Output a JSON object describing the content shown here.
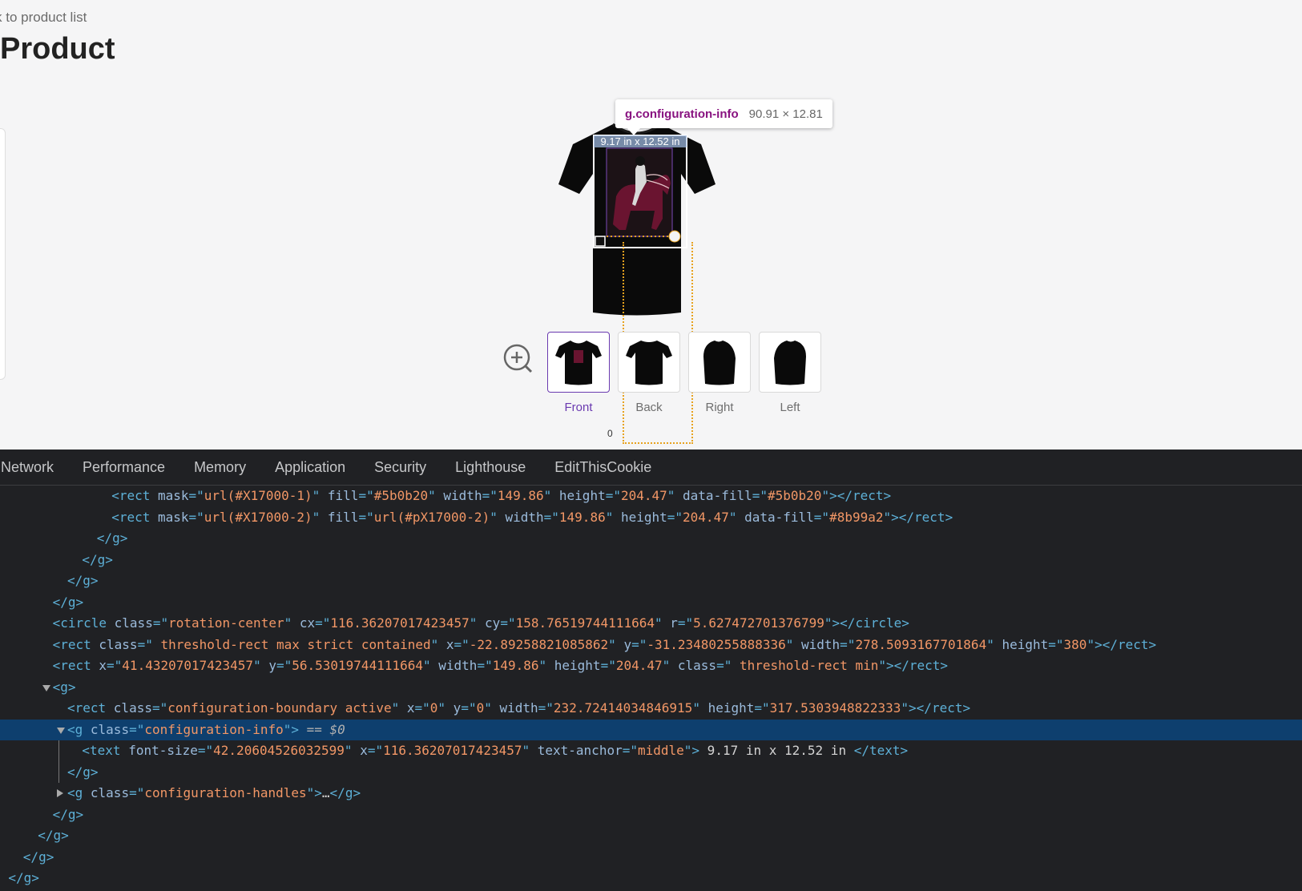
{
  "page": {
    "back_link": "k to product list",
    "title": "Product"
  },
  "inspector_tooltip": {
    "selector": "g.configuration-info",
    "dimensions": "90.91 × 12.81"
  },
  "canvas": {
    "size_label": "9.17 in x 12.52 in",
    "ruler_zero": "0"
  },
  "views": [
    {
      "label": "Front",
      "selected": true
    },
    {
      "label": "Back",
      "selected": false
    },
    {
      "label": "Right",
      "selected": false
    },
    {
      "label": "Left",
      "selected": false
    }
  ],
  "devtools": {
    "tabs": [
      "Network",
      "Performance",
      "Memory",
      "Application",
      "Security",
      "Lighthouse",
      "EditThisCookie"
    ],
    "selected_suffix": " == $0",
    "lines": [
      {
        "indent": 8,
        "parts": [
          [
            "tag",
            "<rect "
          ],
          [
            "at",
            "mask"
          ],
          [
            "tag",
            "=\""
          ],
          [
            "av",
            "url(#X17000-1)"
          ],
          [
            "tag",
            "\" "
          ],
          [
            "at",
            "fill"
          ],
          [
            "tag",
            "=\""
          ],
          [
            "av",
            "#5b0b20"
          ],
          [
            "tag",
            "\" "
          ],
          [
            "at",
            "width"
          ],
          [
            "tag",
            "=\""
          ],
          [
            "av",
            "149.86"
          ],
          [
            "tag",
            "\" "
          ],
          [
            "at",
            "height"
          ],
          [
            "tag",
            "=\""
          ],
          [
            "av",
            "204.47"
          ],
          [
            "tag",
            "\" "
          ],
          [
            "at",
            "data-fill"
          ],
          [
            "tag",
            "=\""
          ],
          [
            "av",
            "#5b0b20"
          ],
          [
            "tag",
            "\"></rect>"
          ]
        ]
      },
      {
        "indent": 8,
        "parts": [
          [
            "tag",
            "<rect "
          ],
          [
            "at",
            "mask"
          ],
          [
            "tag",
            "=\""
          ],
          [
            "av",
            "url(#X17000-2)"
          ],
          [
            "tag",
            "\" "
          ],
          [
            "at",
            "fill"
          ],
          [
            "tag",
            "=\""
          ],
          [
            "av",
            "url(#pX17000-2)"
          ],
          [
            "tag",
            "\" "
          ],
          [
            "at",
            "width"
          ],
          [
            "tag",
            "=\""
          ],
          [
            "av",
            "149.86"
          ],
          [
            "tag",
            "\" "
          ],
          [
            "at",
            "height"
          ],
          [
            "tag",
            "=\""
          ],
          [
            "av",
            "204.47"
          ],
          [
            "tag",
            "\" "
          ],
          [
            "at",
            "data-fill"
          ],
          [
            "tag",
            "=\""
          ],
          [
            "av",
            "#8b99a2"
          ],
          [
            "tag",
            "\"></rect>"
          ]
        ]
      },
      {
        "indent": 7,
        "parts": [
          [
            "tag",
            "</g>"
          ]
        ]
      },
      {
        "indent": 6,
        "parts": [
          [
            "tag",
            "</g>"
          ]
        ]
      },
      {
        "indent": 5,
        "parts": [
          [
            "tag",
            "</g>"
          ]
        ]
      },
      {
        "indent": 4,
        "parts": [
          [
            "tag",
            "</g>"
          ]
        ]
      },
      {
        "indent": 4,
        "parts": [
          [
            "tag",
            "<circle "
          ],
          [
            "at",
            "class"
          ],
          [
            "tag",
            "=\""
          ],
          [
            "av",
            "rotation-center"
          ],
          [
            "tag",
            "\" "
          ],
          [
            "at",
            "cx"
          ],
          [
            "tag",
            "=\""
          ],
          [
            "av",
            "116.36207017423457"
          ],
          [
            "tag",
            "\" "
          ],
          [
            "at",
            "cy"
          ],
          [
            "tag",
            "=\""
          ],
          [
            "av",
            "158.76519744111664"
          ],
          [
            "tag",
            "\" "
          ],
          [
            "at",
            "r"
          ],
          [
            "tag",
            "=\""
          ],
          [
            "av",
            "5.627472701376799"
          ],
          [
            "tag",
            "\"></circle>"
          ]
        ]
      },
      {
        "indent": 4,
        "parts": [
          [
            "tag",
            "<rect "
          ],
          [
            "at",
            "class"
          ],
          [
            "tag",
            "=\""
          ],
          [
            "av",
            " threshold-rect max strict contained"
          ],
          [
            "tag",
            "\" "
          ],
          [
            "at",
            "x"
          ],
          [
            "tag",
            "=\""
          ],
          [
            "av",
            "-22.89258821085862"
          ],
          [
            "tag",
            "\" "
          ],
          [
            "at",
            "y"
          ],
          [
            "tag",
            "=\""
          ],
          [
            "av",
            "-31.23480255888336"
          ],
          [
            "tag",
            "\" "
          ],
          [
            "at",
            "width"
          ],
          [
            "tag",
            "=\""
          ],
          [
            "av",
            "278.5093167701864"
          ],
          [
            "tag",
            "\" "
          ],
          [
            "at",
            "height"
          ],
          [
            "tag",
            "=\""
          ],
          [
            "av",
            "380"
          ],
          [
            "tag",
            "\"></rect>"
          ]
        ]
      },
      {
        "indent": 4,
        "parts": [
          [
            "tag",
            "<rect "
          ],
          [
            "at",
            "x"
          ],
          [
            "tag",
            "=\""
          ],
          [
            "av",
            "41.43207017423457"
          ],
          [
            "tag",
            "\" "
          ],
          [
            "at",
            "y"
          ],
          [
            "tag",
            "=\""
          ],
          [
            "av",
            "56.53019744111664"
          ],
          [
            "tag",
            "\" "
          ],
          [
            "at",
            "width"
          ],
          [
            "tag",
            "=\""
          ],
          [
            "av",
            "149.86"
          ],
          [
            "tag",
            "\" "
          ],
          [
            "at",
            "height"
          ],
          [
            "tag",
            "=\""
          ],
          [
            "av",
            "204.47"
          ],
          [
            "tag",
            "\" "
          ],
          [
            "at",
            "class"
          ],
          [
            "tag",
            "=\""
          ],
          [
            "av",
            " threshold-rect min"
          ],
          [
            "tag",
            "\"></rect>"
          ]
        ]
      },
      {
        "indent": 4,
        "toggle": "down",
        "parts": [
          [
            "tag",
            "<g>"
          ]
        ]
      },
      {
        "indent": 5,
        "parts": [
          [
            "tag",
            "<rect "
          ],
          [
            "at",
            "class"
          ],
          [
            "tag",
            "=\""
          ],
          [
            "av",
            "configuration-boundary active"
          ],
          [
            "tag",
            "\" "
          ],
          [
            "at",
            "x"
          ],
          [
            "tag",
            "=\""
          ],
          [
            "av",
            "0"
          ],
          [
            "tag",
            "\" "
          ],
          [
            "at",
            "y"
          ],
          [
            "tag",
            "=\""
          ],
          [
            "av",
            "0"
          ],
          [
            "tag",
            "\" "
          ],
          [
            "at",
            "width"
          ],
          [
            "tag",
            "=\""
          ],
          [
            "av",
            "232.72414034846915"
          ],
          [
            "tag",
            "\" "
          ],
          [
            "at",
            "height"
          ],
          [
            "tag",
            "=\""
          ],
          [
            "av",
            "317.5303948822333"
          ],
          [
            "tag",
            "\"></rect>"
          ]
        ]
      },
      {
        "indent": 5,
        "toggle": "down",
        "selected": true,
        "parts": [
          [
            "tag",
            "<g "
          ],
          [
            "at",
            "class"
          ],
          [
            "tag",
            "=\""
          ],
          [
            "av",
            "configuration-info"
          ],
          [
            "tag",
            "\">"
          ]
        ]
      },
      {
        "indent": 6,
        "vbar": true,
        "parts": [
          [
            "tag",
            "<text "
          ],
          [
            "at",
            "font-size"
          ],
          [
            "tag",
            "=\""
          ],
          [
            "av",
            "42.20604526032599"
          ],
          [
            "tag",
            "\" "
          ],
          [
            "at",
            "x"
          ],
          [
            "tag",
            "=\""
          ],
          [
            "av",
            "116.36207017423457"
          ],
          [
            "tag",
            "\" "
          ],
          [
            "at",
            "text-anchor"
          ],
          [
            "tag",
            "=\""
          ],
          [
            "av",
            "middle"
          ],
          [
            "tag",
            "\">"
          ],
          [
            "tx",
            " 9.17 in x 12.52 in "
          ],
          [
            "tag",
            "</text>"
          ]
        ]
      },
      {
        "indent": 5,
        "vbar": true,
        "parts": [
          [
            "tag",
            "</g>"
          ]
        ]
      },
      {
        "indent": 5,
        "toggle": "right",
        "parts": [
          [
            "tag",
            "<g "
          ],
          [
            "at",
            "class"
          ],
          [
            "tag",
            "=\""
          ],
          [
            "av",
            "configuration-handles"
          ],
          [
            "tag",
            "\">"
          ],
          [
            "tx",
            "…"
          ],
          [
            "tag",
            "</g>"
          ]
        ]
      },
      {
        "indent": 4,
        "parts": [
          [
            "tag",
            "</g>"
          ]
        ]
      },
      {
        "indent": 3,
        "parts": [
          [
            "tag",
            "</g>"
          ]
        ]
      },
      {
        "indent": 2,
        "parts": [
          [
            "tag",
            "</g>"
          ]
        ]
      },
      {
        "indent": 1,
        "parts": [
          [
            "tag",
            "</g>"
          ]
        ]
      }
    ]
  }
}
